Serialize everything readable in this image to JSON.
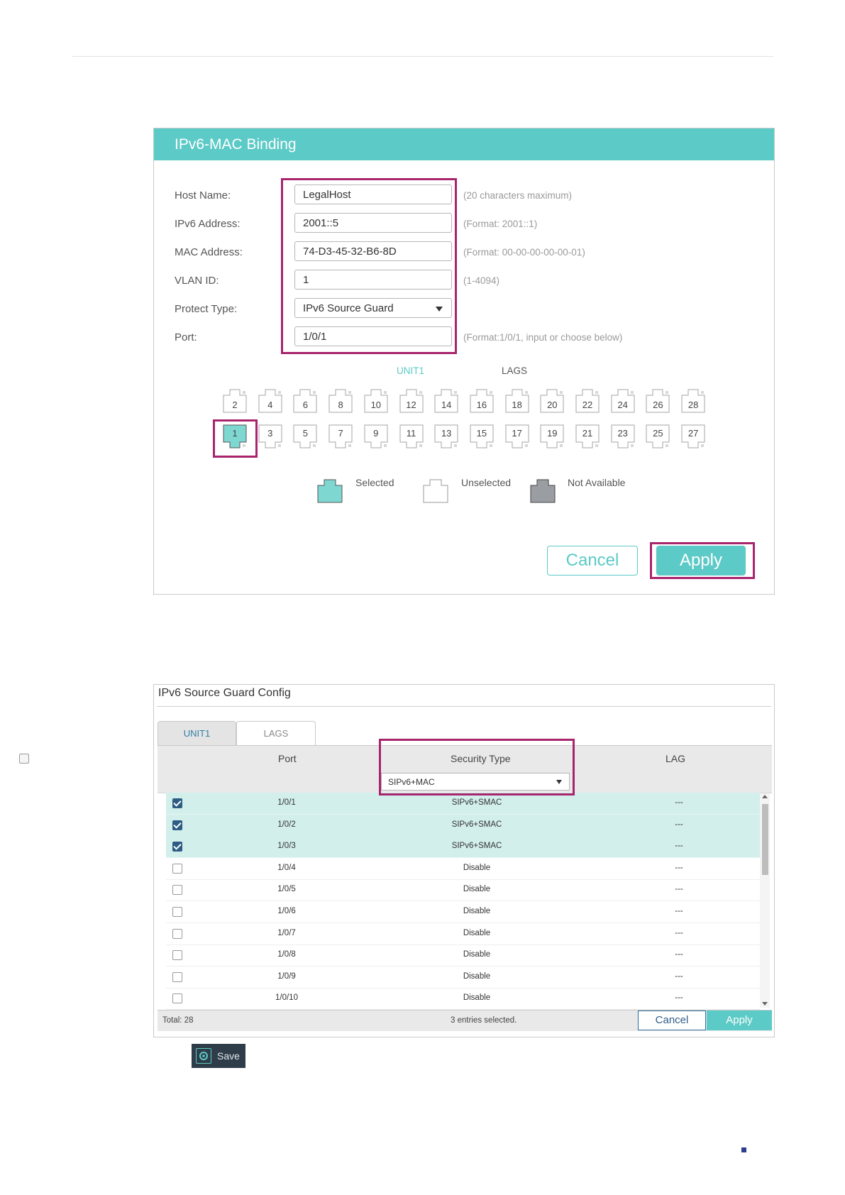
{
  "binding_panel": {
    "title": "IPv6-MAC Binding",
    "host_name": {
      "label": "Host Name:",
      "value": "LegalHost",
      "hint": "(20 characters maximum)"
    },
    "ipv6_address": {
      "label": "IPv6 Address:",
      "value": "2001::5",
      "hint": "(Format: 2001::1)"
    },
    "mac_address": {
      "label": "MAC Address:",
      "value": "74-D3-45-32-B6-8D",
      "hint": "(Format: 00-00-00-00-00-01)"
    },
    "vlan_id": {
      "label": "VLAN ID:",
      "value": "1",
      "hint": "(1-4094)"
    },
    "protect_type": {
      "label": "Protect Type:",
      "value": "IPv6 Source Guard"
    },
    "port": {
      "label": "Port:",
      "value": "1/0/1",
      "hint": "(Format:1/0/1, input or choose below)"
    },
    "port_tabs": [
      "UNIT1",
      "LAGS"
    ],
    "top_ports": [
      "2",
      "4",
      "6",
      "8",
      "10",
      "12",
      "14",
      "16",
      "18",
      "20",
      "22",
      "24",
      "26",
      "28"
    ],
    "bottom_ports": [
      "1",
      "3",
      "5",
      "7",
      "9",
      "11",
      "13",
      "15",
      "17",
      "19",
      "21",
      "23",
      "25",
      "27"
    ],
    "selected_port": "1",
    "legend": {
      "selected": "Selected",
      "unselected": "Unselected",
      "not_available": "Not Available"
    },
    "cancel_label": "Cancel",
    "apply_label": "Apply",
    "colors": {
      "accent": "#5ccac6",
      "highlight": "#a8246d"
    }
  },
  "guard_panel": {
    "title": "IPv6 Source Guard Config",
    "tabs": [
      "UNIT1",
      "LAGS"
    ],
    "columns": [
      "Port",
      "Security Type",
      "LAG"
    ],
    "filter_value": "SIPv6+MAC",
    "rows": [
      {
        "port": "1/0/1",
        "security": "SIPv6+SMAC",
        "lag": "---",
        "checked": true
      },
      {
        "port": "1/0/2",
        "security": "SIPv6+SMAC",
        "lag": "---",
        "checked": true
      },
      {
        "port": "1/0/3",
        "security": "SIPv6+SMAC",
        "lag": "---",
        "checked": true
      },
      {
        "port": "1/0/4",
        "security": "Disable",
        "lag": "---",
        "checked": false
      },
      {
        "port": "1/0/5",
        "security": "Disable",
        "lag": "---",
        "checked": false
      },
      {
        "port": "1/0/6",
        "security": "Disable",
        "lag": "---",
        "checked": false
      },
      {
        "port": "1/0/7",
        "security": "Disable",
        "lag": "---",
        "checked": false
      },
      {
        "port": "1/0/8",
        "security": "Disable",
        "lag": "---",
        "checked": false
      },
      {
        "port": "1/0/9",
        "security": "Disable",
        "lag": "---",
        "checked": false
      },
      {
        "port": "1/0/10",
        "security": "Disable",
        "lag": "---",
        "checked": false
      }
    ],
    "total": "Total: 28",
    "selected_count": "3 entries selected.",
    "cancel_label": "Cancel",
    "apply_label": "Apply"
  },
  "save_label": "Save"
}
